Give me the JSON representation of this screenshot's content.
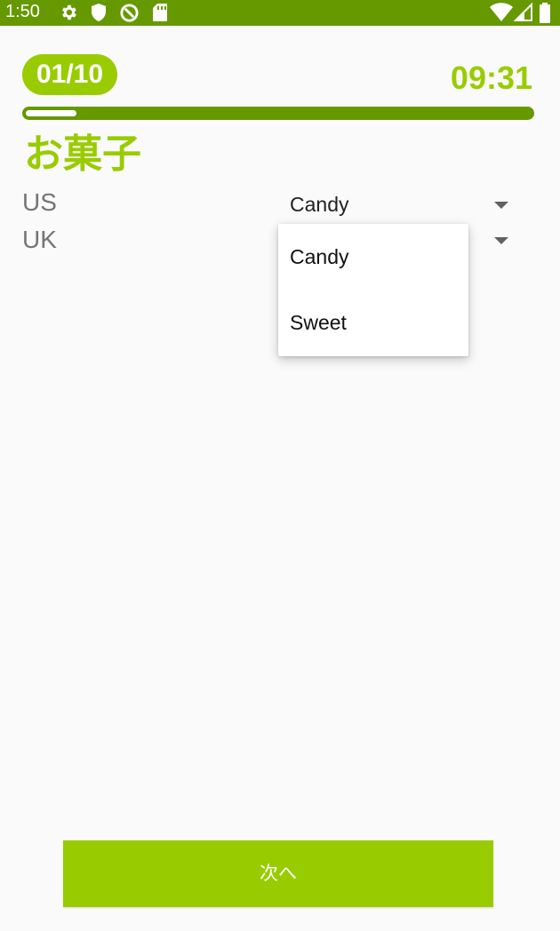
{
  "status_bar": {
    "time": "1:50",
    "left_icons": [
      "gear-icon",
      "shield-icon",
      "data-saver-icon",
      "sd-card-icon"
    ],
    "right_icons": [
      "wifi-icon",
      "signal-icon",
      "battery-icon"
    ],
    "color": "#669900"
  },
  "quiz": {
    "progress_label": "01/10",
    "timer": "09:31",
    "progress_fraction": 0.1,
    "word": "お菓子",
    "accent_color": "#99cc00"
  },
  "rows": [
    {
      "label": "US",
      "selected": "Candy"
    },
    {
      "label": "UK",
      "selected": ""
    }
  ],
  "dropdown": {
    "options": [
      "Candy",
      "Sweet"
    ]
  },
  "next_button": {
    "label": "次へ"
  }
}
